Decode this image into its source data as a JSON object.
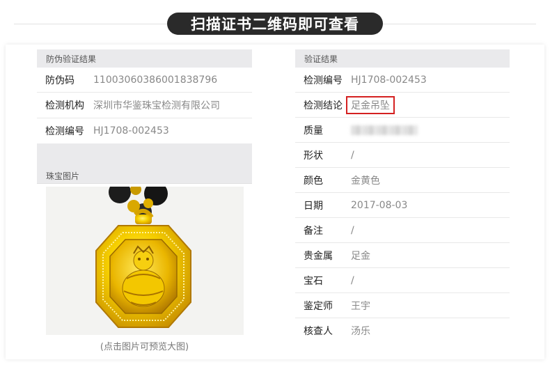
{
  "banner": {
    "title": "扫描证书二维码即可查看"
  },
  "left": {
    "section_title": "防伪验证结果",
    "rows": [
      {
        "label": "防伪码",
        "value": "11003060386001838796"
      },
      {
        "label": "检测机构",
        "value": "深圳市华鉴珠宝检测有限公司"
      },
      {
        "label": "检测编号",
        "value": "HJ1708-002453"
      }
    ],
    "photo_title": "珠宝图片",
    "photo_caption": "(点击图片可预览大图)"
  },
  "right": {
    "section_title": "验证结果",
    "rows": [
      {
        "label": "检测编号",
        "value": "HJ1708-002453"
      },
      {
        "label": "检测结论",
        "value": "足金吊坠"
      },
      {
        "label": "质量",
        "value": ""
      },
      {
        "label": "形状",
        "value": "/"
      },
      {
        "label": "颜色",
        "value": "金黄色"
      },
      {
        "label": "日期",
        "value": "2017-08-03"
      },
      {
        "label": "备注",
        "value": "/"
      },
      {
        "label": "贵金属",
        "value": "足金"
      },
      {
        "label": "宝石",
        "value": "/"
      },
      {
        "label": "鉴定师",
        "value": "王宇"
      },
      {
        "label": "核查人",
        "value": "汤乐"
      }
    ]
  },
  "colors": {
    "highlight": "#d42020",
    "banner_bg": "#2a2a2a",
    "gold": "#f2c400"
  }
}
